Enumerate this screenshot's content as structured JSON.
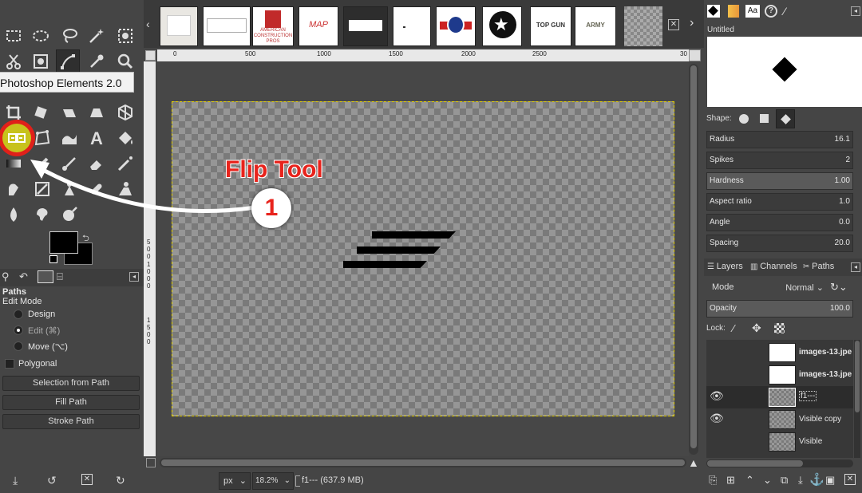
{
  "tooltip": "Photoshop Elements 2.0",
  "annotation": {
    "title": "Flip Tool",
    "number": "1",
    "color": "#e8231c"
  },
  "tool_options": {
    "title": "Paths",
    "edit_mode_label": "Edit Mode",
    "modes": [
      "Design",
      "Edit (⌘)",
      "Move (⌥)"
    ],
    "polygonal_label": "Polygonal",
    "buttons": [
      "Selection from Path",
      "Fill Path",
      "Stroke Path"
    ]
  },
  "image_strip": {
    "thumbs": [
      "",
      "",
      "AMERICAN CONSTRUCTION PROS",
      "MAP",
      "",
      "",
      "",
      "",
      "TOP GUN",
      "ARMY",
      ""
    ]
  },
  "rulers": {
    "h_ticks": [
      "0",
      "500",
      "1000",
      "1500",
      "2000",
      "2500",
      "30"
    ],
    "v_ticks": [
      "5",
      "0",
      "0",
      "1",
      "0",
      "0",
      "0",
      "1",
      "5",
      "0",
      "0"
    ]
  },
  "status": {
    "unit": "px",
    "zoom": "18.2%",
    "info": "f1--- (637.9 MB)"
  },
  "brushes": {
    "name": "Untitled",
    "shape_label": "Shape:",
    "params": [
      {
        "label": "Radius",
        "value": "16.1"
      },
      {
        "label": "Spikes",
        "value": "2"
      },
      {
        "label": "Hardness",
        "value": "1.00"
      },
      {
        "label": "Aspect ratio",
        "value": "1.0"
      },
      {
        "label": "Angle",
        "value": "0.0"
      },
      {
        "label": "Spacing",
        "value": "20.0"
      }
    ]
  },
  "layers": {
    "tabs": [
      "Layers",
      "Channels",
      "Paths"
    ],
    "mode_label": "Mode",
    "mode_value": "Normal",
    "opacity_label": "Opacity",
    "opacity_value": "100.0",
    "lock_label": "Lock:",
    "items": [
      {
        "name": "images-13.jpe",
        "visible": false
      },
      {
        "name": "images-13.jpe",
        "visible": false
      },
      {
        "name": "f1---",
        "visible": true
      },
      {
        "name": "Visible copy",
        "visible": true
      },
      {
        "name": "Visible",
        "visible": false
      }
    ]
  }
}
